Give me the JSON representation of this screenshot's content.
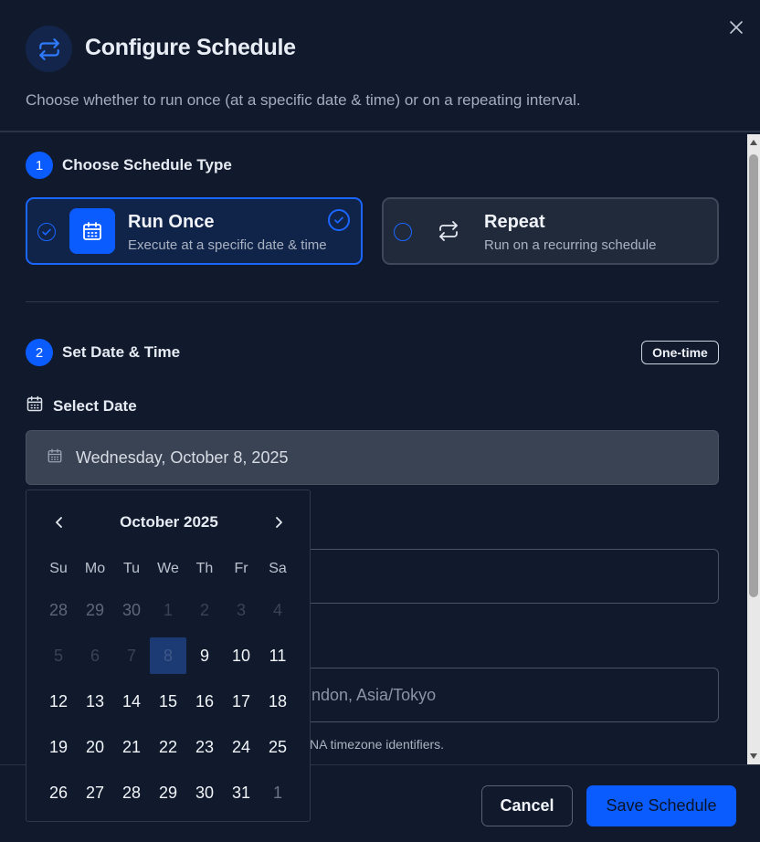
{
  "header": {
    "icon": "repeat-icon",
    "title": "Configure Schedule",
    "subtitle": "Choose whether to run once (at a specific date & time) or on a repeating interval.",
    "close_icon": "close-icon"
  },
  "step1": {
    "number": "1",
    "label": "Choose Schedule Type",
    "options": [
      {
        "title": "Run Once",
        "description": "Execute at a specific date & time",
        "icon": "calendar-icon",
        "selected": true
      },
      {
        "title": "Repeat",
        "description": "Run on a recurring schedule",
        "icon": "repeat-icon",
        "selected": false
      }
    ]
  },
  "step2": {
    "number": "2",
    "label": "Set Date & Time",
    "badge": "One-time",
    "date_label": "Select Date",
    "date_value": "Wednesday, October 8, 2025",
    "timezone_placeholder_visible": "ndon, Asia/Tokyo",
    "timezone_help_visible": "NA timezone identifiers."
  },
  "calendar": {
    "month_label": "October 2025",
    "weekdays": [
      "Su",
      "Mo",
      "Tu",
      "We",
      "Th",
      "Fr",
      "Sa"
    ],
    "weeks": [
      [
        {
          "d": "28",
          "s": "outside"
        },
        {
          "d": "29",
          "s": "outside"
        },
        {
          "d": "30",
          "s": "outside"
        },
        {
          "d": "1",
          "s": "disabled"
        },
        {
          "d": "2",
          "s": "disabled"
        },
        {
          "d": "3",
          "s": "disabled"
        },
        {
          "d": "4",
          "s": "disabled"
        }
      ],
      [
        {
          "d": "5",
          "s": "disabled"
        },
        {
          "d": "6",
          "s": "disabled"
        },
        {
          "d": "7",
          "s": "disabled"
        },
        {
          "d": "8",
          "s": "selected"
        },
        {
          "d": "9",
          "s": "cur"
        },
        {
          "d": "10",
          "s": "cur"
        },
        {
          "d": "11",
          "s": "cur"
        }
      ],
      [
        {
          "d": "12",
          "s": "cur"
        },
        {
          "d": "13",
          "s": "cur"
        },
        {
          "d": "14",
          "s": "cur"
        },
        {
          "d": "15",
          "s": "cur"
        },
        {
          "d": "16",
          "s": "cur"
        },
        {
          "d": "17",
          "s": "cur"
        },
        {
          "d": "18",
          "s": "cur"
        }
      ],
      [
        {
          "d": "19",
          "s": "cur"
        },
        {
          "d": "20",
          "s": "cur"
        },
        {
          "d": "21",
          "s": "cur"
        },
        {
          "d": "22",
          "s": "cur"
        },
        {
          "d": "23",
          "s": "cur"
        },
        {
          "d": "24",
          "s": "cur"
        },
        {
          "d": "25",
          "s": "cur"
        }
      ],
      [
        {
          "d": "26",
          "s": "cur"
        },
        {
          "d": "27",
          "s": "cur"
        },
        {
          "d": "28",
          "s": "cur"
        },
        {
          "d": "29",
          "s": "cur"
        },
        {
          "d": "30",
          "s": "cur"
        },
        {
          "d": "31",
          "s": "cur"
        },
        {
          "d": "1",
          "s": "outside-after"
        }
      ]
    ]
  },
  "footer": {
    "cancel_label": "Cancel",
    "save_label": "Save Schedule"
  },
  "colors": {
    "background": "#111a2c",
    "accent": "#0b5cff",
    "selected_day": "#1c3b75"
  }
}
